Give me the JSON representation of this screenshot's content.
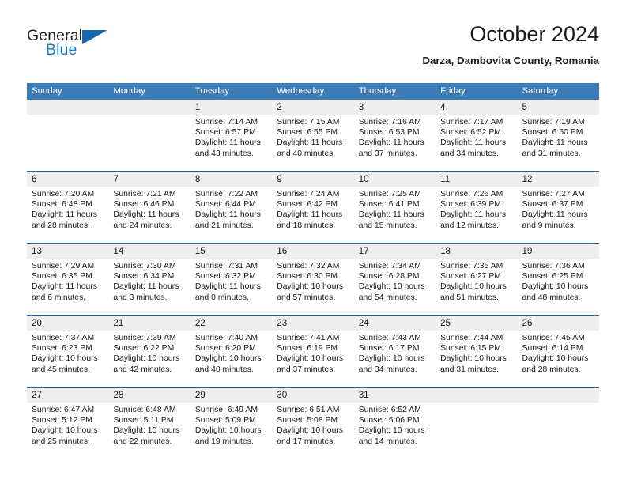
{
  "brand": {
    "line1": "General",
    "line2": "Blue",
    "triangle_color": "#1566ab",
    "blue_color": "#1b7cc2"
  },
  "header": {
    "title": "October 2024",
    "subtitle": "Darza, Dambovita County, Romania",
    "header_bg": "#3b7cb8",
    "rule_color": "#1565a8",
    "daynum_bg": "#efefef"
  },
  "weekday_headers": [
    "Sunday",
    "Monday",
    "Tuesday",
    "Wednesday",
    "Thursday",
    "Friday",
    "Saturday"
  ],
  "labels": {
    "sunrise_prefix": "Sunrise: ",
    "sunset_prefix": "Sunset: ",
    "daylight_prefix": "Daylight: "
  },
  "weeks": [
    [
      {
        "day": "",
        "sunrise": "",
        "sunset": "",
        "daylight_line1": "",
        "daylight_line2": "",
        "blank": true
      },
      {
        "day": "",
        "sunrise": "",
        "sunset": "",
        "daylight_line1": "",
        "daylight_line2": "",
        "blank": true
      },
      {
        "day": "1",
        "sunrise": "Sunrise: 7:14 AM",
        "sunset": "Sunset: 6:57 PM",
        "daylight_line1": "Daylight: 11 hours",
        "daylight_line2": "and 43 minutes."
      },
      {
        "day": "2",
        "sunrise": "Sunrise: 7:15 AM",
        "sunset": "Sunset: 6:55 PM",
        "daylight_line1": "Daylight: 11 hours",
        "daylight_line2": "and 40 minutes."
      },
      {
        "day": "3",
        "sunrise": "Sunrise: 7:16 AM",
        "sunset": "Sunset: 6:53 PM",
        "daylight_line1": "Daylight: 11 hours",
        "daylight_line2": "and 37 minutes."
      },
      {
        "day": "4",
        "sunrise": "Sunrise: 7:17 AM",
        "sunset": "Sunset: 6:52 PM",
        "daylight_line1": "Daylight: 11 hours",
        "daylight_line2": "and 34 minutes."
      },
      {
        "day": "5",
        "sunrise": "Sunrise: 7:19 AM",
        "sunset": "Sunset: 6:50 PM",
        "daylight_line1": "Daylight: 11 hours",
        "daylight_line2": "and 31 minutes."
      }
    ],
    [
      {
        "day": "6",
        "sunrise": "Sunrise: 7:20 AM",
        "sunset": "Sunset: 6:48 PM",
        "daylight_line1": "Daylight: 11 hours",
        "daylight_line2": "and 28 minutes."
      },
      {
        "day": "7",
        "sunrise": "Sunrise: 7:21 AM",
        "sunset": "Sunset: 6:46 PM",
        "daylight_line1": "Daylight: 11 hours",
        "daylight_line2": "and 24 minutes."
      },
      {
        "day": "8",
        "sunrise": "Sunrise: 7:22 AM",
        "sunset": "Sunset: 6:44 PM",
        "daylight_line1": "Daylight: 11 hours",
        "daylight_line2": "and 21 minutes."
      },
      {
        "day": "9",
        "sunrise": "Sunrise: 7:24 AM",
        "sunset": "Sunset: 6:42 PM",
        "daylight_line1": "Daylight: 11 hours",
        "daylight_line2": "and 18 minutes."
      },
      {
        "day": "10",
        "sunrise": "Sunrise: 7:25 AM",
        "sunset": "Sunset: 6:41 PM",
        "daylight_line1": "Daylight: 11 hours",
        "daylight_line2": "and 15 minutes."
      },
      {
        "day": "11",
        "sunrise": "Sunrise: 7:26 AM",
        "sunset": "Sunset: 6:39 PM",
        "daylight_line1": "Daylight: 11 hours",
        "daylight_line2": "and 12 minutes."
      },
      {
        "day": "12",
        "sunrise": "Sunrise: 7:27 AM",
        "sunset": "Sunset: 6:37 PM",
        "daylight_line1": "Daylight: 11 hours",
        "daylight_line2": "and 9 minutes."
      }
    ],
    [
      {
        "day": "13",
        "sunrise": "Sunrise: 7:29 AM",
        "sunset": "Sunset: 6:35 PM",
        "daylight_line1": "Daylight: 11 hours",
        "daylight_line2": "and 6 minutes."
      },
      {
        "day": "14",
        "sunrise": "Sunrise: 7:30 AM",
        "sunset": "Sunset: 6:34 PM",
        "daylight_line1": "Daylight: 11 hours",
        "daylight_line2": "and 3 minutes."
      },
      {
        "day": "15",
        "sunrise": "Sunrise: 7:31 AM",
        "sunset": "Sunset: 6:32 PM",
        "daylight_line1": "Daylight: 11 hours",
        "daylight_line2": "and 0 minutes."
      },
      {
        "day": "16",
        "sunrise": "Sunrise: 7:32 AM",
        "sunset": "Sunset: 6:30 PM",
        "daylight_line1": "Daylight: 10 hours",
        "daylight_line2": "and 57 minutes."
      },
      {
        "day": "17",
        "sunrise": "Sunrise: 7:34 AM",
        "sunset": "Sunset: 6:28 PM",
        "daylight_line1": "Daylight: 10 hours",
        "daylight_line2": "and 54 minutes."
      },
      {
        "day": "18",
        "sunrise": "Sunrise: 7:35 AM",
        "sunset": "Sunset: 6:27 PM",
        "daylight_line1": "Daylight: 10 hours",
        "daylight_line2": "and 51 minutes."
      },
      {
        "day": "19",
        "sunrise": "Sunrise: 7:36 AM",
        "sunset": "Sunset: 6:25 PM",
        "daylight_line1": "Daylight: 10 hours",
        "daylight_line2": "and 48 minutes."
      }
    ],
    [
      {
        "day": "20",
        "sunrise": "Sunrise: 7:37 AM",
        "sunset": "Sunset: 6:23 PM",
        "daylight_line1": "Daylight: 10 hours",
        "daylight_line2": "and 45 minutes."
      },
      {
        "day": "21",
        "sunrise": "Sunrise: 7:39 AM",
        "sunset": "Sunset: 6:22 PM",
        "daylight_line1": "Daylight: 10 hours",
        "daylight_line2": "and 42 minutes."
      },
      {
        "day": "22",
        "sunrise": "Sunrise: 7:40 AM",
        "sunset": "Sunset: 6:20 PM",
        "daylight_line1": "Daylight: 10 hours",
        "daylight_line2": "and 40 minutes."
      },
      {
        "day": "23",
        "sunrise": "Sunrise: 7:41 AM",
        "sunset": "Sunset: 6:19 PM",
        "daylight_line1": "Daylight: 10 hours",
        "daylight_line2": "and 37 minutes."
      },
      {
        "day": "24",
        "sunrise": "Sunrise: 7:43 AM",
        "sunset": "Sunset: 6:17 PM",
        "daylight_line1": "Daylight: 10 hours",
        "daylight_line2": "and 34 minutes."
      },
      {
        "day": "25",
        "sunrise": "Sunrise: 7:44 AM",
        "sunset": "Sunset: 6:15 PM",
        "daylight_line1": "Daylight: 10 hours",
        "daylight_line2": "and 31 minutes."
      },
      {
        "day": "26",
        "sunrise": "Sunrise: 7:45 AM",
        "sunset": "Sunset: 6:14 PM",
        "daylight_line1": "Daylight: 10 hours",
        "daylight_line2": "and 28 minutes."
      }
    ],
    [
      {
        "day": "27",
        "sunrise": "Sunrise: 6:47 AM",
        "sunset": "Sunset: 5:12 PM",
        "daylight_line1": "Daylight: 10 hours",
        "daylight_line2": "and 25 minutes."
      },
      {
        "day": "28",
        "sunrise": "Sunrise: 6:48 AM",
        "sunset": "Sunset: 5:11 PM",
        "daylight_line1": "Daylight: 10 hours",
        "daylight_line2": "and 22 minutes."
      },
      {
        "day": "29",
        "sunrise": "Sunrise: 6:49 AM",
        "sunset": "Sunset: 5:09 PM",
        "daylight_line1": "Daylight: 10 hours",
        "daylight_line2": "and 19 minutes."
      },
      {
        "day": "30",
        "sunrise": "Sunrise: 6:51 AM",
        "sunset": "Sunset: 5:08 PM",
        "daylight_line1": "Daylight: 10 hours",
        "daylight_line2": "and 17 minutes."
      },
      {
        "day": "31",
        "sunrise": "Sunrise: 6:52 AM",
        "sunset": "Sunset: 5:06 PM",
        "daylight_line1": "Daylight: 10 hours",
        "daylight_line2": "and 14 minutes."
      },
      {
        "day": "",
        "sunrise": "",
        "sunset": "",
        "daylight_line1": "",
        "daylight_line2": "",
        "blank": true
      },
      {
        "day": "",
        "sunrise": "",
        "sunset": "",
        "daylight_line1": "",
        "daylight_line2": "",
        "blank": true
      }
    ]
  ]
}
